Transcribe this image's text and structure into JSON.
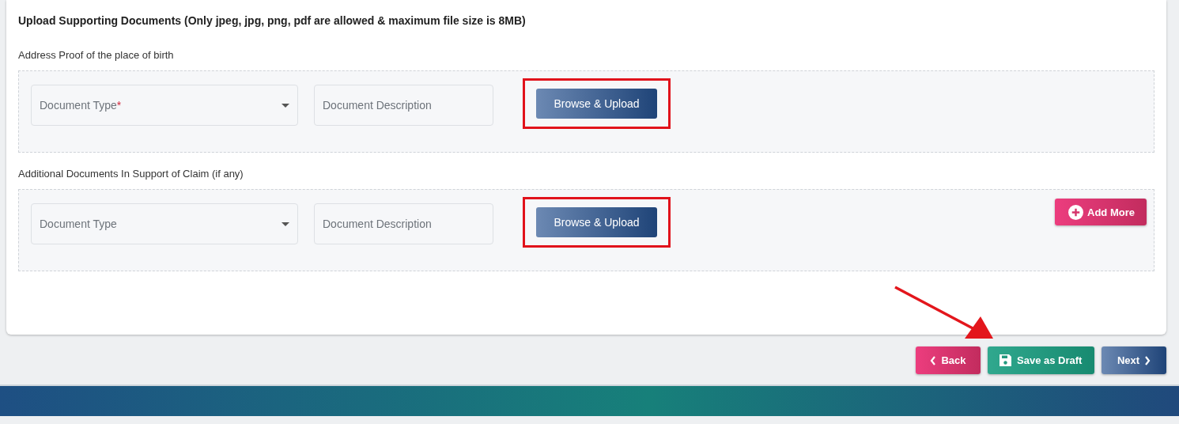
{
  "heading": "Upload Supporting Documents (Only jpeg, jpg, png, pdf are allowed & maximum file size is 8MB)",
  "sections": [
    {
      "label": "Address Proof of the place of birth",
      "type_field": {
        "placeholder": "Document Type",
        "required_mark": "*"
      },
      "description_field": {
        "placeholder": "Document Description"
      },
      "upload_button": {
        "label": "Browse & Upload",
        "highlighted": true
      }
    },
    {
      "label": "Additional Documents In Support of Claim (if any)",
      "type_field": {
        "placeholder": "Document Type"
      },
      "description_field": {
        "placeholder": "Document Description"
      },
      "upload_button": {
        "label": "Browse & Upload",
        "highlighted": true
      },
      "add_more": {
        "label": "Add More"
      }
    }
  ],
  "footer_buttons": [
    {
      "kind": "back",
      "label": "Back"
    },
    {
      "kind": "save",
      "label": "Save as Draft"
    },
    {
      "kind": "next",
      "label": "Next"
    }
  ],
  "annotations": [
    {
      "kind": "arrow"
    }
  ]
}
